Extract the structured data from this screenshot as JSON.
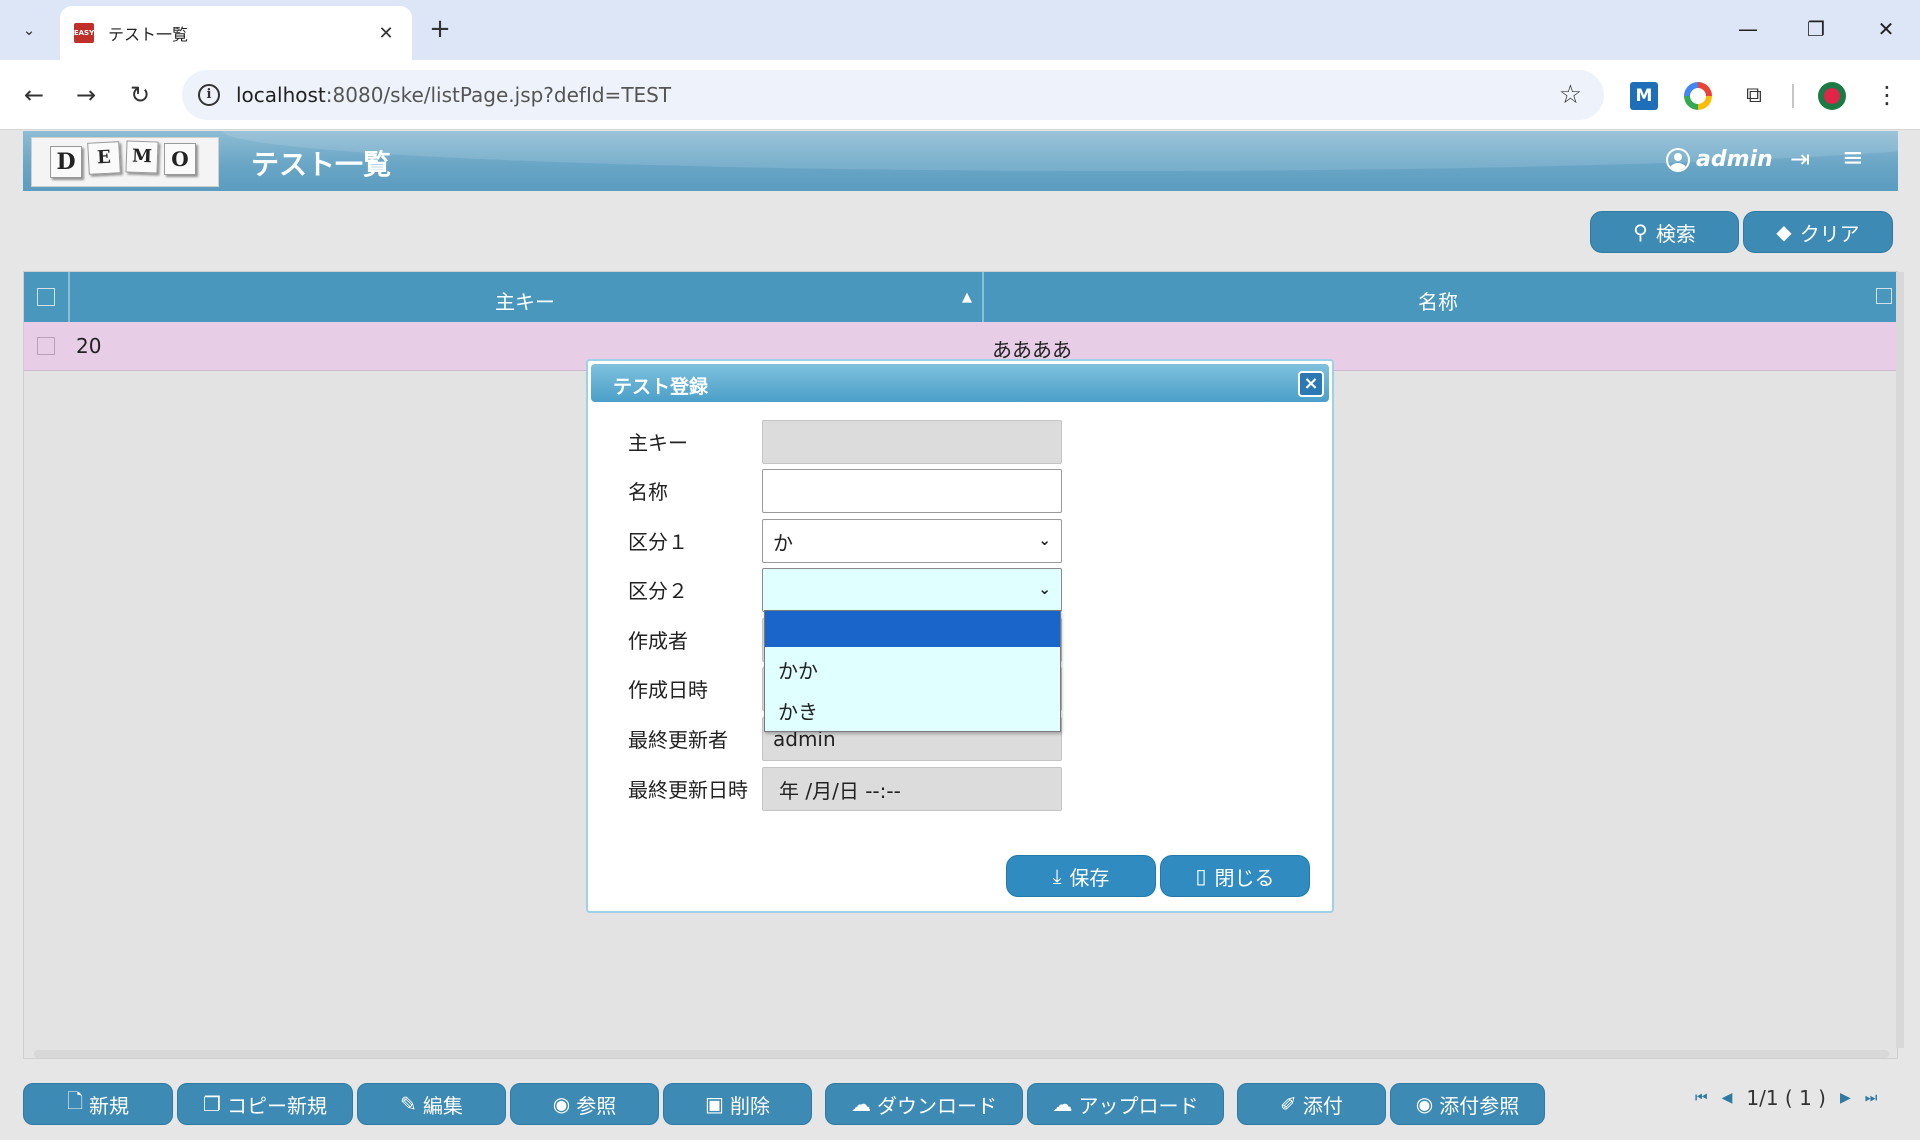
{
  "browser": {
    "tab_title": "テスト一覧",
    "favicon_text": "EASY",
    "url_host": "localhost",
    "url_rest": ":8080/ske/listPage.jsp?defId=TEST"
  },
  "header": {
    "logo_letters": [
      "D",
      "E",
      "M",
      "O"
    ],
    "title": "テスト一覧",
    "user": "admin"
  },
  "search": {
    "search_label": "検索",
    "clear_label": "クリア"
  },
  "grid": {
    "columns": [
      "主キー",
      "名称"
    ],
    "rows": [
      {
        "key": "20",
        "name": "ああああ"
      }
    ]
  },
  "dialog": {
    "title": "テスト登録",
    "fields": [
      {
        "label": "主キー",
        "value": ""
      },
      {
        "label": "名称",
        "value": ""
      },
      {
        "label": "区分１",
        "value": "か"
      },
      {
        "label": "区分２",
        "value": ""
      },
      {
        "label": "作成者",
        "value": ""
      },
      {
        "label": "作成日時",
        "value": ""
      },
      {
        "label": "最終更新者",
        "value": "admin"
      },
      {
        "label": "最終更新日時",
        "value": "年 /月/日  --:--"
      }
    ],
    "dropdown_options": [
      "",
      "かか",
      "かき"
    ],
    "save_label": "保存",
    "close_label": "閉じる"
  },
  "actions": {
    "new": "新規",
    "copy_new": "コピー新規",
    "edit": "編集",
    "view": "参照",
    "delete": "削除",
    "download": "ダウンロード",
    "upload": "アップロード",
    "attach": "添付",
    "attach_view": "添付参照"
  },
  "pager": {
    "text": "1/1 ( 1 )"
  },
  "colors": {
    "accent": "#3d8ab4",
    "header_blue": "#4a97bd",
    "row_highlight": "#e7cde6",
    "dropdown_bg": "#e0ffff",
    "dropdown_selected": "#1a65c9"
  }
}
